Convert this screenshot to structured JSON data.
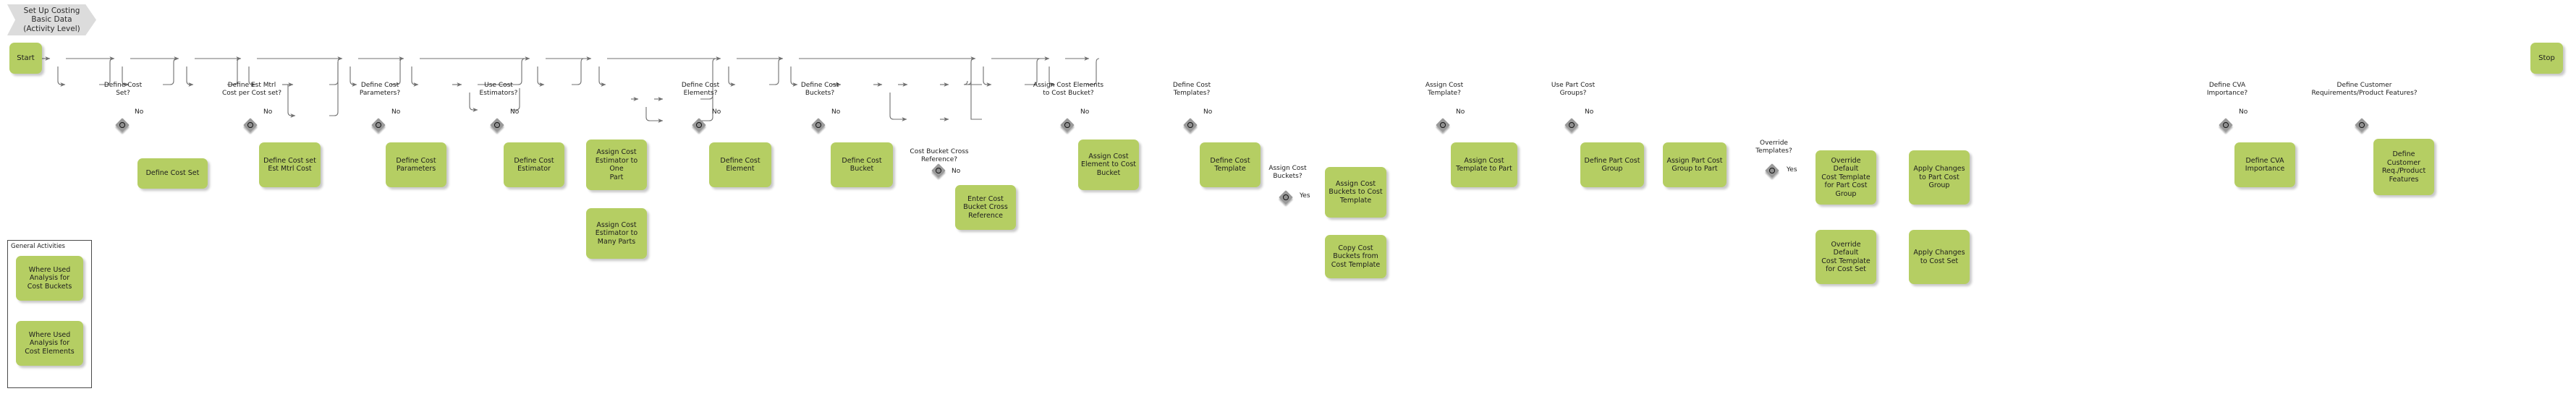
{
  "banner": {
    "label": "Set Up Costing\nBasic Data\n(Activity Level)"
  },
  "terminators": {
    "start": "Start",
    "stop": "Stop"
  },
  "edge_labels": {
    "no": "No",
    "yes": "Yes"
  },
  "gateways": [
    {
      "id": "gw-define-cost-set",
      "label": "Define Cost\nSet?",
      "branch": "No"
    },
    {
      "id": "gw-define-est-mtrl-cost",
      "label": "Define Est Mtrl\nCost per Cost set?",
      "branch": "No"
    },
    {
      "id": "gw-define-cost-parameters",
      "label": "Define Cost\nParameters?",
      "branch": "No"
    },
    {
      "id": "gw-use-cost-estimators",
      "label": "Use Cost\nEstimators?",
      "branch": "No"
    },
    {
      "id": "gw-define-cost-elements",
      "label": "Define Cost\nElements?",
      "branch": "No"
    },
    {
      "id": "gw-define-cost-buckets",
      "label": "Define Cost\nBuckets?",
      "branch": "No"
    },
    {
      "id": "gw-cost-bucket-xref",
      "label": "Cost Bucket Cross\nReference?",
      "branch": "No"
    },
    {
      "id": "gw-assign-cost-elements",
      "label": "Assign Cost Elements\nto Cost Bucket?",
      "branch": "No"
    },
    {
      "id": "gw-define-cost-templates",
      "label": "Define Cost\nTemplates?",
      "branch": "No"
    },
    {
      "id": "gw-assign-cost-buckets",
      "label": "Assign Cost\nBuckets?",
      "branch": "Yes"
    },
    {
      "id": "gw-assign-cost-template",
      "label": "Assign Cost\nTemplate?",
      "branch": "No"
    },
    {
      "id": "gw-use-part-cost-groups",
      "label": "Use Part Cost\nGroups?",
      "branch": "No"
    },
    {
      "id": "gw-override-templates",
      "label": "Override\nTemplates?",
      "branch": "Yes"
    },
    {
      "id": "gw-define-cva-importance",
      "label": "Define CVA\nImportance?",
      "branch": "No"
    },
    {
      "id": "gw-define-customer-reqs",
      "label": "Define Customer\nRequirements/Product Features?",
      "branch": ""
    }
  ],
  "tasks": [
    {
      "id": "task-define-cost-set",
      "label": "Define Cost Set"
    },
    {
      "id": "task-define-cost-set-est-mtrl-cost",
      "label": "Define Cost set\nEst Mtrl Cost"
    },
    {
      "id": "task-define-cost-parameters",
      "label": "Define Cost\nParameters"
    },
    {
      "id": "task-define-cost-estimator",
      "label": "Define Cost\nEstimator"
    },
    {
      "id": "task-assign-cost-estimator-one-part",
      "label": "Assign Cost\nEstimator to One\nPart"
    },
    {
      "id": "task-assign-cost-estimator-many-parts",
      "label": "Assign Cost\nEstimator to\nMany Parts"
    },
    {
      "id": "task-define-cost-element",
      "label": "Define Cost\nElement"
    },
    {
      "id": "task-define-cost-bucket",
      "label": "Define Cost\nBucket"
    },
    {
      "id": "task-enter-cost-bucket-xref",
      "label": "Enter Cost\nBucket Cross\nReference"
    },
    {
      "id": "task-assign-cost-element-to-bucket",
      "label": "Assign Cost\nElement to Cost\nBucket"
    },
    {
      "id": "task-define-cost-template",
      "label": "Define Cost\nTemplate"
    },
    {
      "id": "task-assign-cost-buckets-to-template",
      "label": "Assign Cost\nBuckets to Cost\nTemplate"
    },
    {
      "id": "task-copy-cost-buckets-from-template",
      "label": "Copy Cost\nBuckets from\nCost Template"
    },
    {
      "id": "task-assign-cost-template-to-part",
      "label": "Assign Cost\nTemplate to Part"
    },
    {
      "id": "task-define-part-cost-group",
      "label": "Define Part Cost\nGroup"
    },
    {
      "id": "task-assign-part-cost-group-to-part",
      "label": "Assign Part Cost\nGroup to Part"
    },
    {
      "id": "task-override-default-template-pcg",
      "label": "Override Default\nCost Template\nfor Part Cost\nGroup"
    },
    {
      "id": "task-apply-changes-to-part-cost-group",
      "label": "Apply Changes\nto Part Cost\nGroup"
    },
    {
      "id": "task-override-default-template-cs",
      "label": "Override Default\nCost Template\nfor Cost Set"
    },
    {
      "id": "task-apply-changes-to-cost-set",
      "label": "Apply Changes\nto Cost Set"
    },
    {
      "id": "task-define-cva-importance",
      "label": "Define CVA\nImportance"
    },
    {
      "id": "task-define-customer-req-product-features",
      "label": "Define\nCustomer\nReq./Product\nFeatures"
    }
  ],
  "legend": {
    "title": "General Activities",
    "items": [
      {
        "id": "legend-where-used-cost-buckets",
        "label": "Where Used\nAnalysis for\nCost Buckets"
      },
      {
        "id": "legend-where-used-cost-elements",
        "label": "Where Used\nAnalysis for\nCost Elements"
      }
    ]
  },
  "colors": {
    "task_fill": "#b5ce63",
    "banner_fill": "#dcdcdc",
    "gateway_fill": "#9a9a9a",
    "line": "#707070",
    "text": "#1c1c1c"
  }
}
